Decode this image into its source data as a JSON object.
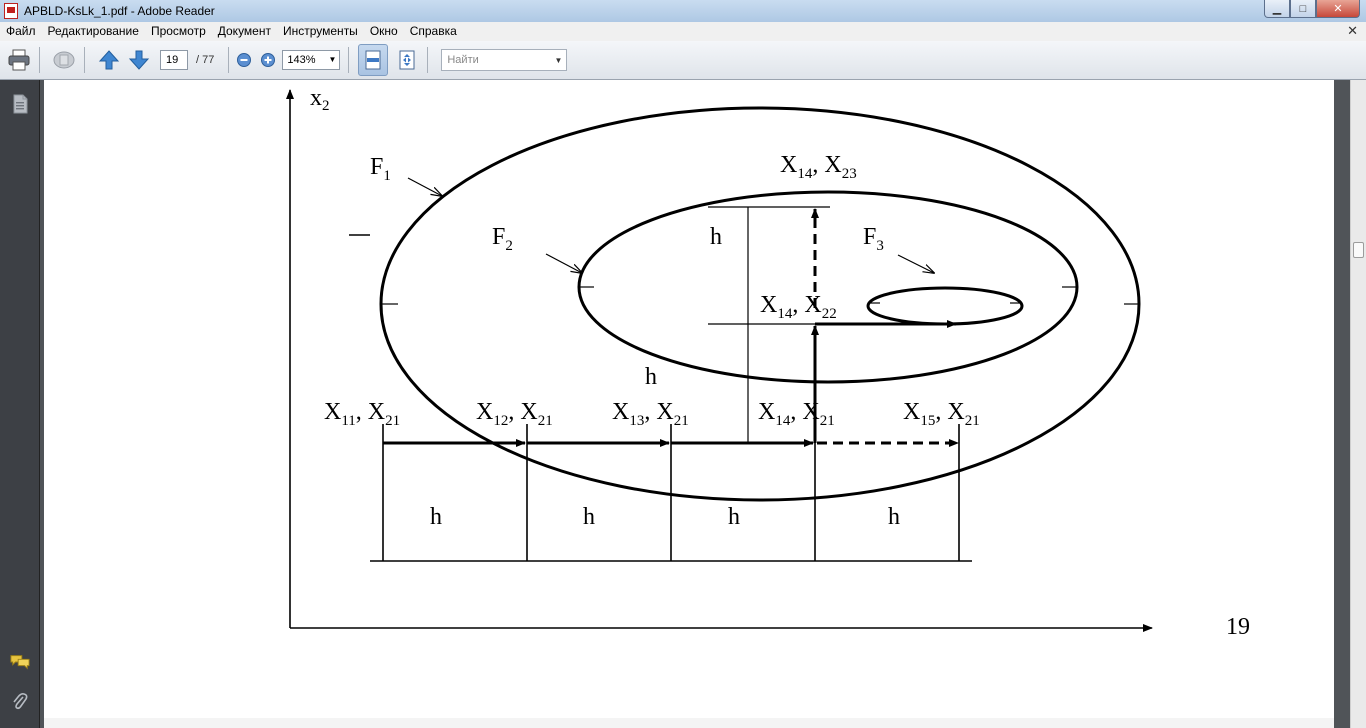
{
  "window": {
    "title": "APBLD-KsLk_1.pdf - Adobe Reader",
    "controls": {
      "minimize": "▁",
      "maximize": "□",
      "close": "✕"
    }
  },
  "menu": {
    "items": [
      "Файл",
      "Редактирование",
      "Просмотр",
      "Документ",
      "Инструменты",
      "Окно",
      "Справка"
    ],
    "close": "✕"
  },
  "toolbar": {
    "page_current": "19",
    "page_total": "/ 77",
    "zoom": "143%",
    "find_placeholder": "Найти"
  },
  "page": {
    "page_number": "19",
    "labels": {
      "x2": "x",
      "x2_sub": "2",
      "f1": "F",
      "f1_sub": "1",
      "f2": "F",
      "f2_sub": "2",
      "f3": "F",
      "f3_sub": "3",
      "h": "h",
      "x14_23_a": "X",
      "x14_23_a_sub": "14",
      "x14_23_b": ", X",
      "x14_23_b_sub": "23",
      "x14_22_a": "X",
      "x14_22_a_sub": "14",
      "x14_22_b": ", X",
      "x14_22_b_sub": "22"
    },
    "bottom_points": [
      {
        "a": "X",
        "a_sub": "11",
        "b": ", X",
        "b_sub": "21"
      },
      {
        "a": "X",
        "a_sub": "12",
        "b": ", X",
        "b_sub": "21"
      },
      {
        "a": "X",
        "a_sub": "13",
        "b": ", X",
        "b_sub": "21"
      },
      {
        "a": "X",
        "a_sub": "14",
        "b": ", X",
        "b_sub": "21"
      },
      {
        "a": "X",
        "a_sub": "15",
        "b": ", X",
        "b_sub": "21"
      }
    ]
  }
}
